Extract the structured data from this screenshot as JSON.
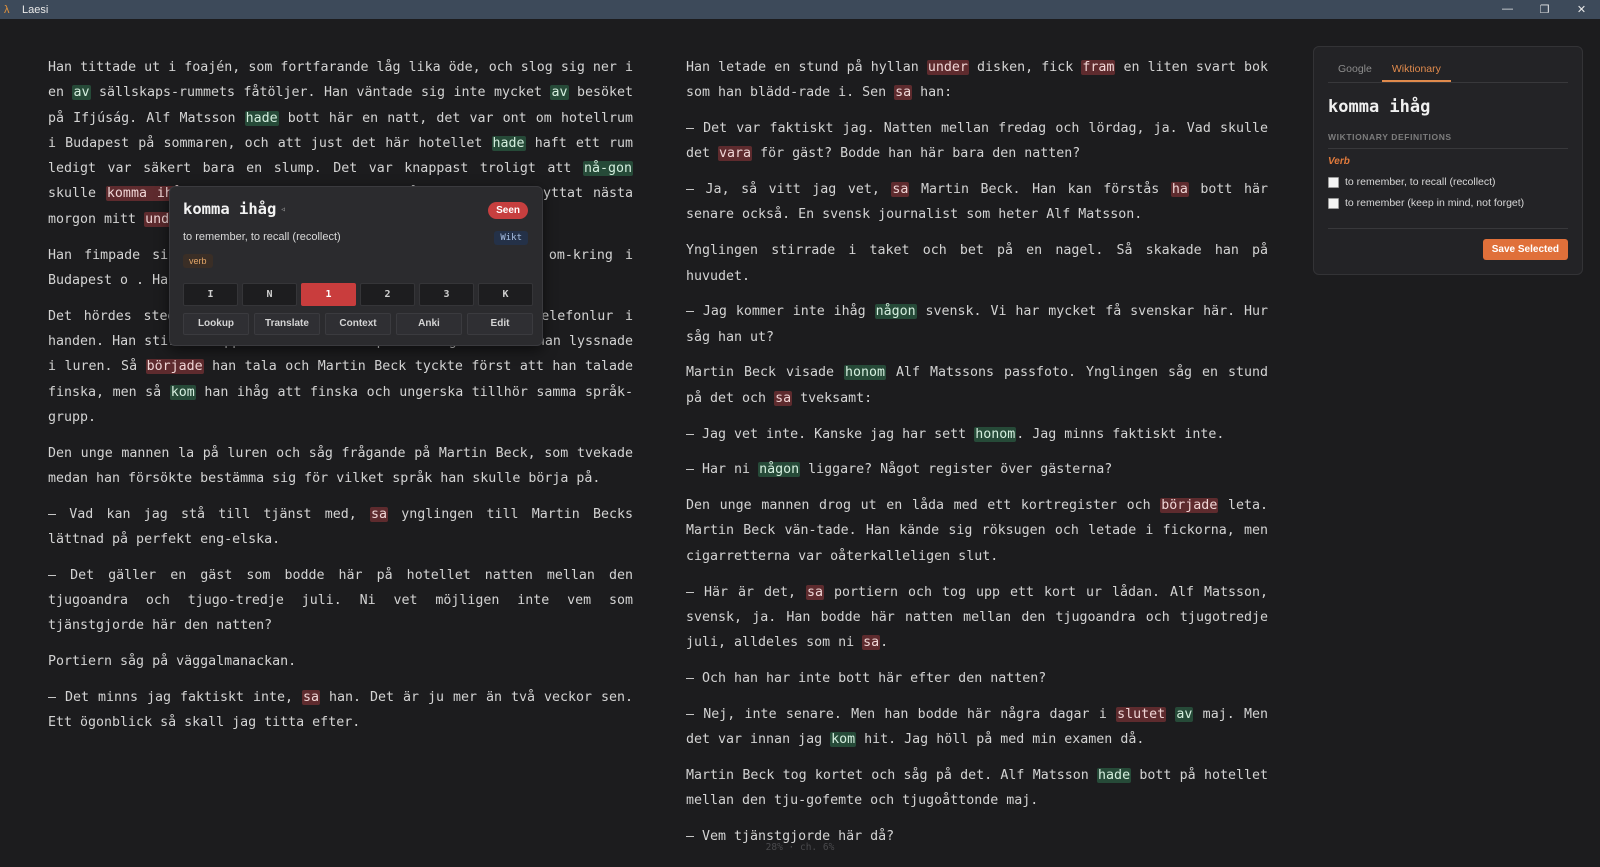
{
  "window": {
    "app_icon": "lambda-icon",
    "title": "Laesi",
    "controls": {
      "minimize": "—",
      "restore": "❐",
      "close": "✕"
    }
  },
  "reader": {
    "left_paragraphs": [
      [
        {
          "t": "Han tittade ut i foajén, som fortfarande låg lika öde, och slog sig ner i en "
        },
        {
          "t": "av",
          "h": "g"
        },
        {
          "t": " sällskaps-rummets fåtöljer. Han väntade sig inte mycket "
        },
        {
          "t": "av",
          "h": "g"
        },
        {
          "t": " besöket på Ifjúság. Alf Matsson "
        },
        {
          "t": "hade",
          "h": "g"
        },
        {
          "t": " bott här en natt, det var ont om hotellrum i Budapest på sommaren, och att just det här hotellet "
        },
        {
          "t": "hade",
          "h": "g"
        },
        {
          "t": " haft ett rum ledigt var säkert bara en slump. Det var knappast troligt att "
        },
        {
          "t": "nå-gon",
          "h": "g"
        },
        {
          "t": " skulle "
        },
        {
          "t": "komma ihåg",
          "h": "r"
        },
        {
          "t": " en gäst som kommit sent på kvällen och flyttat nästa morgon mitt "
        },
        {
          "t": "under",
          "h": "r"
        },
        {
          "t": " högsäsongen."
        }
      ],
      [
        {
          "t": "Han fimpade sin si                                                                                omarna ute på gräsmattan. Det                                                                                e ranta om-kring i Budapest o                                                                                . Han kunde inte minnas att ha"
        }
      ],
      [
        {
          "t": "Det hördes steg ute                                                           man stod bakom portierdisken med en telefonlur i handen. Han stirrade upp i taket och bet på tum-nageln medan han lyssnade i luren. Så "
        },
        {
          "t": "började",
          "h": "r"
        },
        {
          "t": " han tala och Martin Beck tyckte först att han talade finska, men så "
        },
        {
          "t": "kom",
          "h": "g"
        },
        {
          "t": " han ihåg att finska och ungerska tillhör samma språk-grupp."
        }
      ],
      [
        {
          "t": "Den unge mannen la på luren och såg frågande på Martin Beck, som tvekade medan han försökte bestämma sig för vilket språk han skulle börja på."
        }
      ],
      [
        {
          "t": "– Vad kan jag stå till tjänst med, "
        },
        {
          "t": "sa",
          "h": "r"
        },
        {
          "t": " ynglingen till Martin Becks lättnad på perfekt eng-elska."
        }
      ],
      [
        {
          "t": "– Det gäller en gäst som bodde här på hotellet natten mellan den tjugoandra och tjugo-tredje juli. Ni vet möjligen inte vem som tjänstgjorde här den natten?"
        }
      ],
      [
        {
          "t": "Portiern såg på väggalmanackan."
        }
      ],
      [
        {
          "t": "– Det minns jag faktiskt inte, "
        },
        {
          "t": "sa",
          "h": "r"
        },
        {
          "t": " han. Det är ju mer än två veckor sen. Ett ögonblick så skall jag titta efter."
        }
      ]
    ],
    "right_paragraphs": [
      [
        {
          "t": "Han letade en stund på hyllan "
        },
        {
          "t": "under",
          "h": "r"
        },
        {
          "t": " disken, fick "
        },
        {
          "t": "fram",
          "h": "r"
        },
        {
          "t": " en liten svart bok som han blädd-rade i. Sen "
        },
        {
          "t": "sa",
          "h": "r"
        },
        {
          "t": " han:"
        }
      ],
      [
        {
          "t": "– Det var faktiskt jag. Natten mellan fredag och lördag, ja. Vad skulle det "
        },
        {
          "t": "vara",
          "h": "r"
        },
        {
          "t": " för gäst? Bodde han här bara den natten?"
        }
      ],
      [
        {
          "t": "– Ja, så vitt jag vet, "
        },
        {
          "t": "sa",
          "h": "r"
        },
        {
          "t": " Martin Beck. Han kan förstås "
        },
        {
          "t": "ha",
          "h": "r"
        },
        {
          "t": " bott här senare också. En svensk journalist som heter Alf Matsson."
        }
      ],
      [
        {
          "t": "Ynglingen stirrade i taket och bet på en nagel. Så skakade han på huvudet."
        }
      ],
      [
        {
          "t": "– Jag kommer inte ihåg "
        },
        {
          "t": "någon",
          "h": "g"
        },
        {
          "t": " svensk. Vi har mycket få svenskar här. Hur såg han ut?"
        }
      ],
      [
        {
          "t": "Martin Beck visade "
        },
        {
          "t": "honom",
          "h": "g"
        },
        {
          "t": " Alf Matssons passfoto. Ynglingen såg en stund på det och "
        },
        {
          "t": "sa",
          "h": "r"
        },
        {
          "t": " tveksamt:"
        }
      ],
      [
        {
          "t": "– Jag vet inte. Kanske jag har sett "
        },
        {
          "t": "honom",
          "h": "g"
        },
        {
          "t": ". Jag minns faktiskt inte."
        }
      ],
      [
        {
          "t": "– Har ni "
        },
        {
          "t": "någon",
          "h": "g"
        },
        {
          "t": " liggare? Något register över gästerna?"
        }
      ],
      [
        {
          "t": "Den unge mannen drog ut en låda med ett kortregister och "
        },
        {
          "t": "började",
          "h": "r"
        },
        {
          "t": " leta. Martin Beck vän-tade. Han kände sig röksugen och letade i fickorna, men cigarretterna var oåterkalleligen slut."
        }
      ],
      [
        {
          "t": "– Här är det, "
        },
        {
          "t": "sa",
          "h": "r"
        },
        {
          "t": " portiern och tog upp ett kort ur lådan. Alf Matsson, svensk, ja. Han bodde här natten mellan den tjugoandra och tjugotredje juli, alldeles som ni "
        },
        {
          "t": "sa",
          "h": "r"
        },
        {
          "t": "."
        }
      ],
      [
        {
          "t": "– Och han har inte bott här efter den natten?"
        }
      ],
      [
        {
          "t": "– Nej, inte senare. Men han bodde här några dagar i "
        },
        {
          "t": "slutet",
          "h": "r"
        },
        {
          "t": " "
        },
        {
          "t": "av",
          "h": "g"
        },
        {
          "t": " maj. Men det var innan jag "
        },
        {
          "t": "kom",
          "h": "g"
        },
        {
          "t": " hit. Jag höll på med min examen då."
        }
      ],
      [
        {
          "t": "Martin Beck tog kortet och såg på det. Alf Matsson "
        },
        {
          "t": "hade",
          "h": "g"
        },
        {
          "t": " bott på hotellet mellan den tju-gofemte och tjugoåttonde maj."
        }
      ],
      [
        {
          "t": "– Vem tjänstgjorde här då?"
        }
      ]
    ],
    "progress_text": "28% · ch. 6%"
  },
  "popup": {
    "word": "komma ihåg",
    "speaker_glyph": "◃",
    "seen_badge": "Seen",
    "definition": "to remember, to recall (recollect)",
    "source_badge": "Wikt",
    "pos": "verb",
    "ratings": [
      "I",
      "N",
      "1",
      "2",
      "3",
      "K"
    ],
    "active_rating": "1",
    "actions": [
      "Lookup",
      "Translate",
      "Context",
      "Anki",
      "Edit"
    ]
  },
  "sidebar": {
    "tabs": [
      "Google",
      "Wiktionary"
    ],
    "active_tab": "Wiktionary",
    "word": "komma ihåg",
    "section_label": "WIKTIONARY DEFINITIONS",
    "pos_label": "Verb",
    "definitions": [
      "to remember, to recall (recollect)",
      "to remember (keep in mind, not forget)"
    ],
    "save_label": "Save Selected"
  },
  "colors": {
    "accent": "#e0703a",
    "unknown_highlight": "#5e2b2e",
    "known_highlight": "#264a38",
    "seen_badge": "#c73f3f",
    "active_rating": "#c93d3d"
  }
}
